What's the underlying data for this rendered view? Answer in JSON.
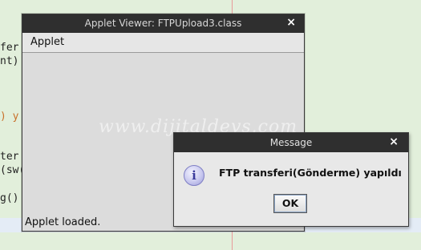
{
  "editor": {
    "code_fragments": [
      {
        "text": "fer",
        "color": "#222222"
      },
      {
        "text": "nt)",
        "color": "#222222"
      },
      {
        "text": ") y",
        "color": "#c8702a"
      },
      {
        "text": "ter",
        "color": "#222222"
      },
      {
        "text": "(sw(",
        "color": "#222222"
      },
      {
        "text": "g()",
        "color": "#222222"
      }
    ]
  },
  "applet_window": {
    "title": "Applet Viewer: FTPUpload3.class",
    "close_glyph": "×",
    "menu_label": "Applet",
    "watermark": "www.dijitaldevs.com",
    "status_text": "Applet loaded."
  },
  "message_dialog": {
    "title": "Message",
    "close_glyph": "×",
    "icon": "info-icon",
    "icon_glyph": "i",
    "message": "FTP transferi(Gönderme) yapıldı",
    "ok_label": "OK"
  }
}
